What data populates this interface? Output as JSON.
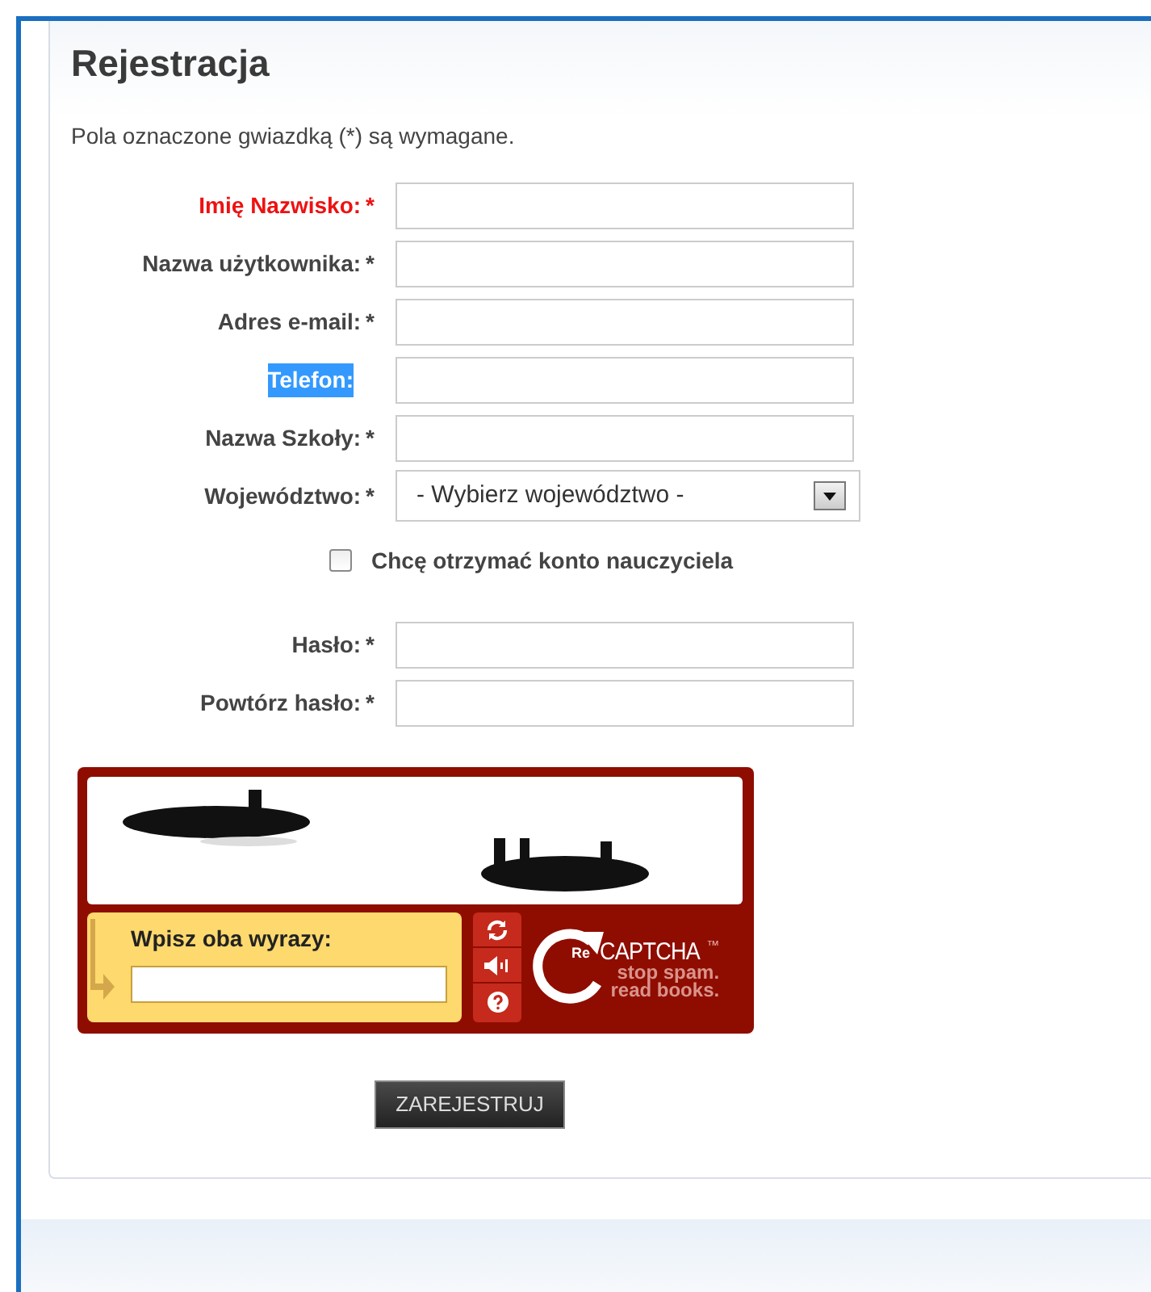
{
  "title": "Rejestracja",
  "intro": "Pola oznaczone gwiazdką (*) są wymagane.",
  "fields": [
    {
      "kind": "text",
      "label": "Imię Nazwisko:",
      "required": true,
      "error": true,
      "highlighted": false
    },
    {
      "kind": "text",
      "label": "Nazwa użytkownika:",
      "required": true,
      "error": false,
      "highlighted": false
    },
    {
      "kind": "text",
      "label": "Adres e-mail:",
      "required": true,
      "error": false,
      "highlighted": false
    },
    {
      "kind": "text",
      "label": "Telefon:",
      "required": false,
      "error": false,
      "highlighted": true
    },
    {
      "kind": "text",
      "label": "Nazwa Szkoły:",
      "required": true,
      "error": false,
      "highlighted": false
    },
    {
      "kind": "select",
      "label": "Województwo:",
      "required": true,
      "error": false,
      "highlighted": false,
      "value": "- Wybierz województwo -"
    },
    {
      "kind": "checkbox",
      "label": "Chcę otrzymać konto nauczyciela",
      "checked": false
    },
    {
      "kind": "password",
      "label": "Hasło:",
      "required": true,
      "error": false,
      "highlighted": false
    },
    {
      "kind": "password",
      "label": "Powtórz hasło:",
      "required": true,
      "error": false,
      "highlighted": false
    }
  ],
  "required_mark": "*",
  "captcha": {
    "prompt": "Wpisz oba wyrazy:",
    "logo_prefix": "Re",
    "logo_name": "CAPTCHA",
    "logo_tm": "™",
    "tagline": [
      "stop spam.",
      "read books."
    ]
  },
  "submit": "ZAREJESTRUJ"
}
